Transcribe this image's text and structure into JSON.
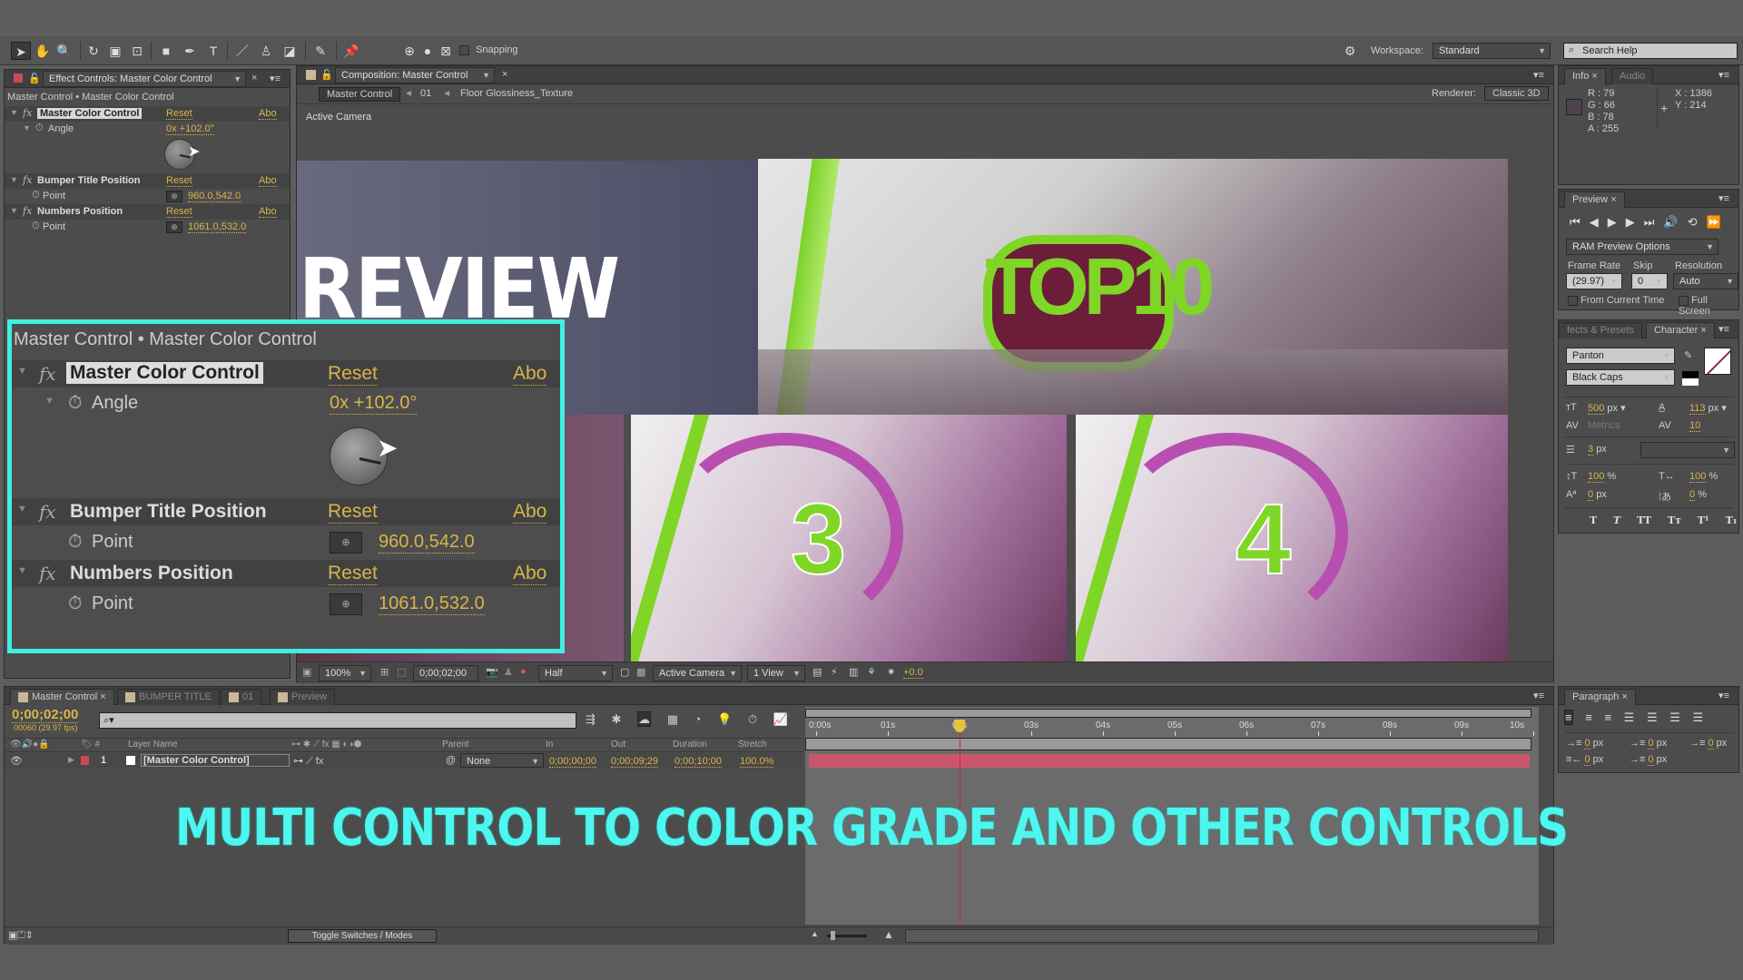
{
  "toolbar": {
    "snapping_label": "Snapping",
    "workspace_label": "Workspace:",
    "workspace_value": "Standard",
    "search_placeholder": "Search Help"
  },
  "effect_controls": {
    "tab_title": "Effect Controls: Master Color Control",
    "breadcrumb": "Master Control • Master Color Control",
    "effects": [
      {
        "name": "Master Color Control",
        "reset": "Reset",
        "about": "Abo",
        "param": "Angle",
        "value": "0x +102.0°"
      },
      {
        "name": "Bumper Title Position",
        "reset": "Reset",
        "about": "Abo",
        "param": "Point",
        "value": "960.0,542.0"
      },
      {
        "name": "Numbers Position",
        "reset": "Reset",
        "about": "Abo",
        "param": "Point",
        "value": "1061.0,532.0"
      }
    ]
  },
  "composition": {
    "tab_title": "Composition: Master Control",
    "crumbs": [
      "Master Control",
      "01",
      "Floor Glossiness_Texture"
    ],
    "renderer_label": "Renderer:",
    "renderer_value": "Classic 3D",
    "camera_label": "Active Camera",
    "preview_title": "REVIEW",
    "preview_numbers": [
      "3",
      "4"
    ],
    "footer": {
      "zoom": "100%",
      "timecode": "0;00;02;00",
      "resolution": "Half",
      "camera": "Active Camera",
      "views": "1 View",
      "exposure": "+0.0"
    }
  },
  "info": {
    "tabs": [
      "Info",
      "Audio"
    ],
    "r": "R : 79",
    "g": "G : 66",
    "b": "B : 78",
    "a": "A : 255",
    "x": "X : 1386",
    "y": "Y : 214",
    "swatch_color": "#4f424e"
  },
  "preview": {
    "tab": "Preview",
    "ram_options": "RAM Preview Options",
    "frame_rate_label": "Frame Rate",
    "frame_rate": "(29.97)",
    "skip_label": "Skip",
    "skip": "0",
    "resolution_label": "Resolution",
    "resolution": "Auto",
    "from_current": "From Current Time",
    "full_screen": "Full Screen"
  },
  "character": {
    "tabs": [
      "fects & Presets",
      "Character"
    ],
    "font": "Panton",
    "style": "Black Caps",
    "size": "500",
    "leading": "113",
    "kerning": "Metrics",
    "tracking": "10",
    "stroke": "3",
    "vscale": "100",
    "hscale": "100",
    "baseline": "0",
    "tsume": "0",
    "unit_px": "px",
    "unit_pct": "%"
  },
  "paragraph": {
    "tab": "Paragraph",
    "indents": [
      "0",
      "0",
      "0",
      "0",
      "0"
    ],
    "unit": "px"
  },
  "timeline": {
    "tabs": [
      "Master Control",
      "BUMPER TITLE",
      "01",
      "Preview"
    ],
    "current_time": "0;00;02;00",
    "frame_info": "00060 (29.97 fps)",
    "columns": [
      "Layer Name",
      "Parent",
      "In",
      "Out",
      "Duration",
      "Stretch"
    ],
    "layers": [
      {
        "num": "1",
        "name": "[Master Color Control]",
        "parent": "None",
        "in": "0;00;00;00",
        "out": "0;00;09;29",
        "duration": "0;00;10;00",
        "stretch": "100.0%"
      }
    ],
    "ruler": [
      "0:00s",
      "01s",
      "02s",
      "03s",
      "04s",
      "05s",
      "06s",
      "07s",
      "08s",
      "09s",
      "10s"
    ],
    "playhead_seconds": 2,
    "toggle_label": "Toggle Switches / Modes"
  },
  "caption": "MULTI CONTROL TO COLOR GRADE AND OTHER CONTROLS"
}
